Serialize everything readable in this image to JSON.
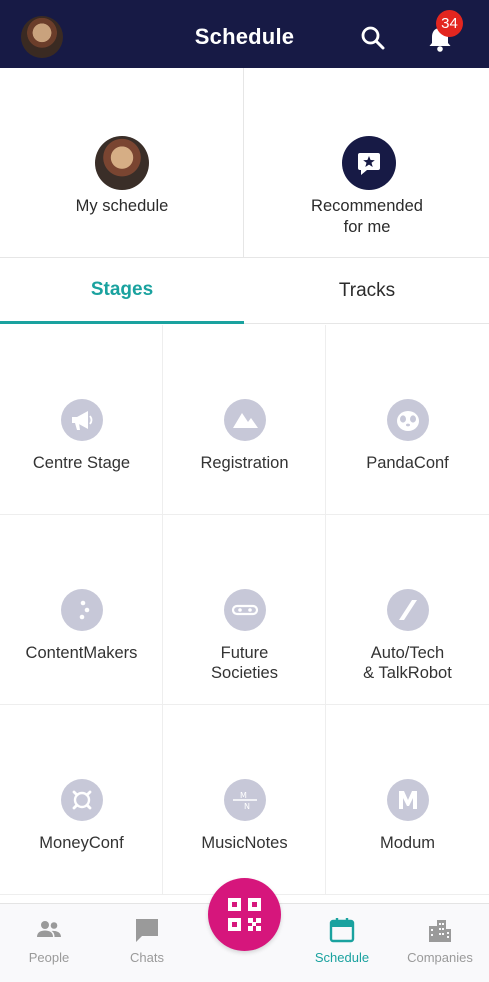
{
  "header": {
    "title": "Schedule",
    "notification_count": "34"
  },
  "cards": {
    "my_schedule": "My schedule",
    "recommended_line1": "Recommended",
    "recommended_line2": "for me"
  },
  "tabs": [
    {
      "label": "Stages",
      "active": true
    },
    {
      "label": "Tracks",
      "active": false
    }
  ],
  "stages": [
    {
      "line1": "Centre Stage",
      "line2": "",
      "icon": "megaphone-icon"
    },
    {
      "line1": "Registration",
      "line2": "",
      "icon": "mountains-icon"
    },
    {
      "line1": "PandaConf",
      "line2": "",
      "icon": "panda-icon"
    },
    {
      "line1": "ContentMakers",
      "line2": "",
      "icon": "dots-icon"
    },
    {
      "line1": "Future",
      "line2": "Societies",
      "icon": "link-icon"
    },
    {
      "line1": "Auto/Tech",
      "line2": "& TalkRobot",
      "icon": "slash-icon"
    },
    {
      "line1": "MoneyConf",
      "line2": "",
      "icon": "moneyconf-icon"
    },
    {
      "line1": "MusicNotes",
      "line2": "",
      "icon": "musicnotes-icon"
    },
    {
      "line1": "Modum",
      "line2": "",
      "icon": "modum-icon"
    }
  ],
  "nav": [
    {
      "label": "People",
      "icon": "people-icon",
      "active": false
    },
    {
      "label": "Chats",
      "icon": "chat-icon",
      "active": false
    },
    {
      "label": "Schedule",
      "icon": "calendar-icon",
      "active": true
    },
    {
      "label": "Companies",
      "icon": "buildings-icon",
      "active": false
    }
  ],
  "colors": {
    "header": "#171a45",
    "accent": "#1aa29f",
    "fab": "#d6167c",
    "badge": "#e3261f",
    "icon_bg": "#c7c8d8"
  }
}
